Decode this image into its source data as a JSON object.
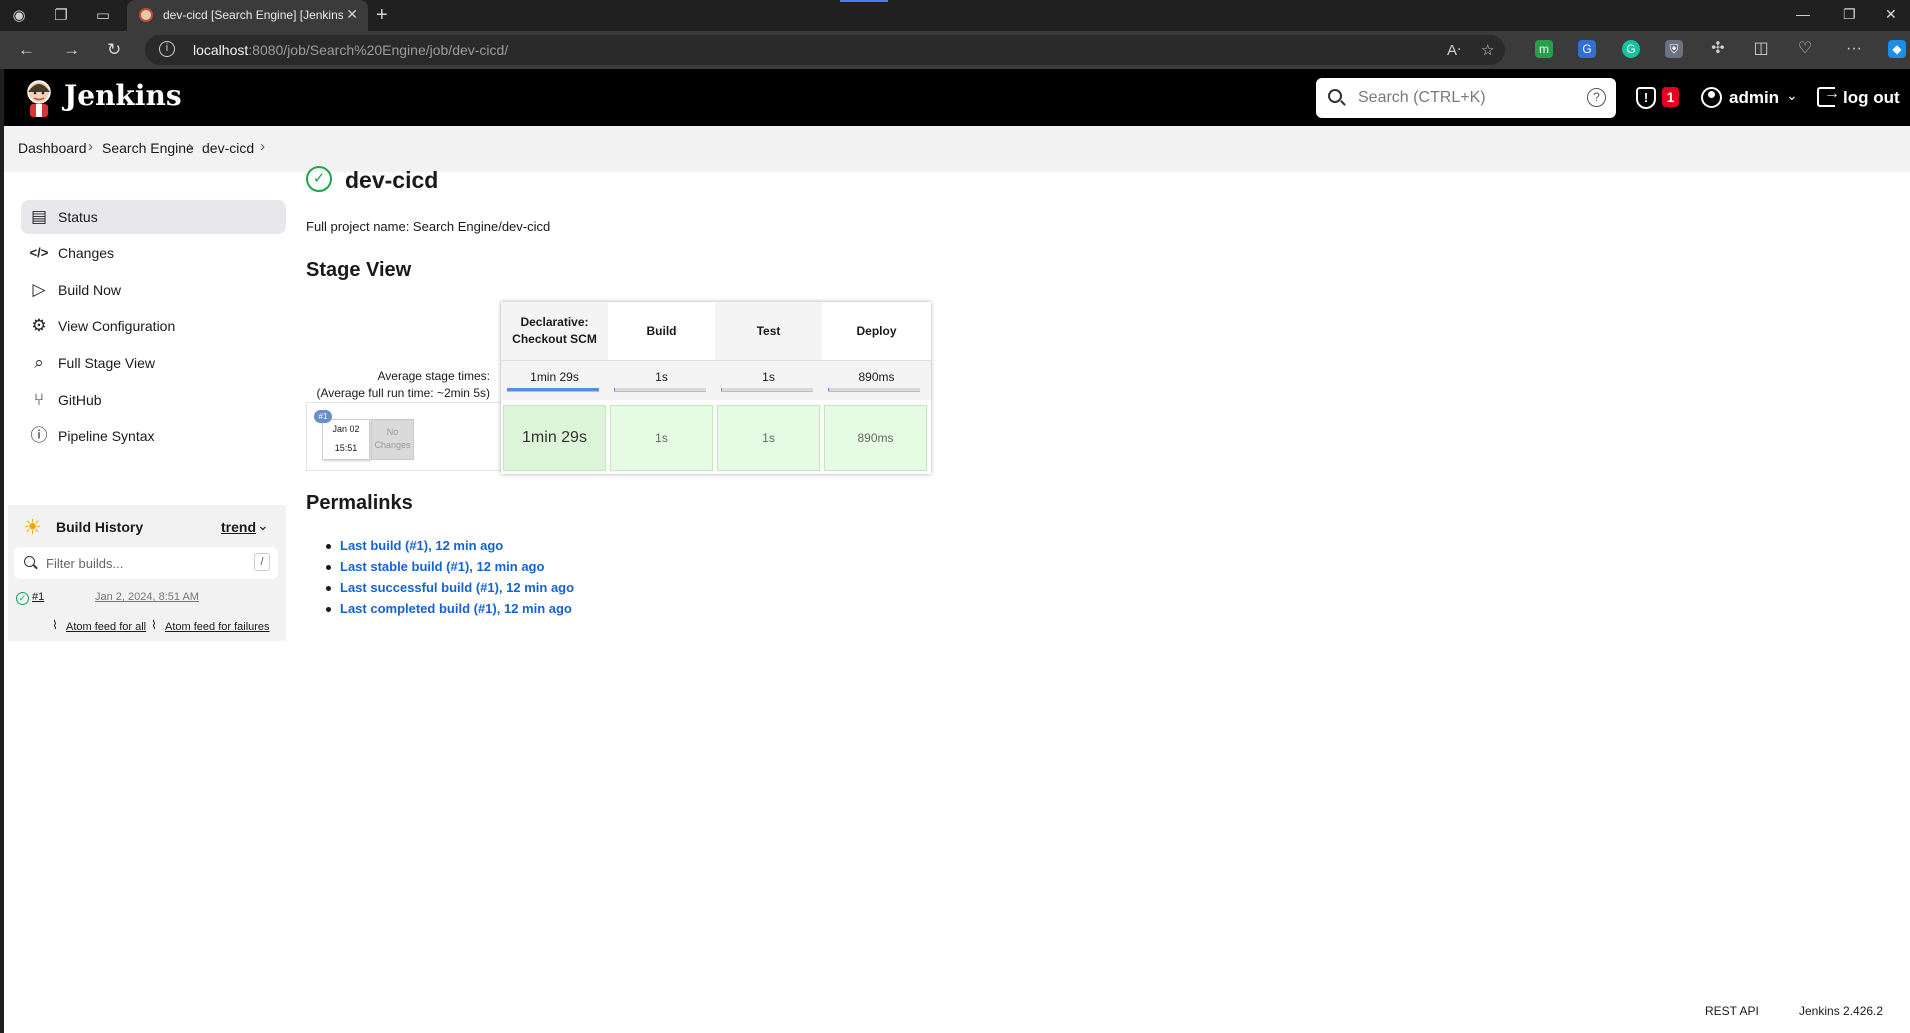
{
  "browser": {
    "tab_title": "dev-cicd [Search Engine] [Jenkins]",
    "url_host": "localhost",
    "url_path": ":8080/job/Search%20Engine/job/dev-cicd/"
  },
  "header": {
    "brand": "Jenkins",
    "search_placeholder": "Search (CTRL+K)",
    "help": "?",
    "security_count": "1",
    "user": "admin",
    "logout": "log out"
  },
  "breadcrumbs": [
    "Dashboard",
    "Search Engine",
    "dev-cicd"
  ],
  "sidebar": {
    "items": [
      {
        "label": "Status",
        "icon": "document-icon"
      },
      {
        "label": "Changes",
        "icon": "code-icon"
      },
      {
        "label": "Build Now",
        "icon": "play-icon"
      },
      {
        "label": "View Configuration",
        "icon": "gear-icon"
      },
      {
        "label": "Full Stage View",
        "icon": "search-icon"
      },
      {
        "label": "GitHub",
        "icon": "branch-icon"
      },
      {
        "label": "Pipeline Syntax",
        "icon": "help-icon"
      }
    ]
  },
  "build_history": {
    "title": "Build History",
    "trend": "trend",
    "filter_placeholder": "Filter builds...",
    "filter_key": "/",
    "builds": [
      {
        "number": "#1",
        "date": "Jan 2, 2024, 8:51 AM",
        "status": "success"
      }
    ],
    "feed_all": "Atom feed for all",
    "feed_failures": "Atom feed for failures"
  },
  "main": {
    "title": "dev-cicd",
    "full_name": "Full project name: Search Engine/dev-cicd",
    "stage_view_heading": "Stage View",
    "avg_label": "Average stage times:",
    "avg_full_label": "(Average full run time: ~2min 5s)",
    "stages": [
      {
        "name": "Declarative: Checkout SCM",
        "avg": "1min 29s",
        "avg_fraction": 1.0,
        "run": "1min 29s"
      },
      {
        "name": "Build",
        "avg": "1s",
        "avg_fraction": 0.01,
        "run": "1s"
      },
      {
        "name": "Test",
        "avg": "1s",
        "avg_fraction": 0.01,
        "run": "1s"
      },
      {
        "name": "Deploy",
        "avg": "890ms",
        "avg_fraction": 0.01,
        "run": "890ms"
      }
    ],
    "run": {
      "badge": "#1",
      "date": "Jan 02",
      "time": "15:51",
      "changes_line1": "No",
      "changes_line2": "Changes"
    },
    "permalinks_heading": "Permalinks",
    "permalinks": [
      "Last build (#1), 12 min ago",
      "Last stable build (#1), 12 min ago",
      "Last successful build (#1), 12 min ago",
      "Last completed build (#1), 12 min ago"
    ]
  },
  "footer": {
    "rest_api": "REST API",
    "version": "Jenkins 2.426.2"
  },
  "colors": {
    "success": "#1ea64b",
    "link": "#1463d6",
    "stage_ok": "#ddf5d8",
    "header_bg": "#000000"
  }
}
